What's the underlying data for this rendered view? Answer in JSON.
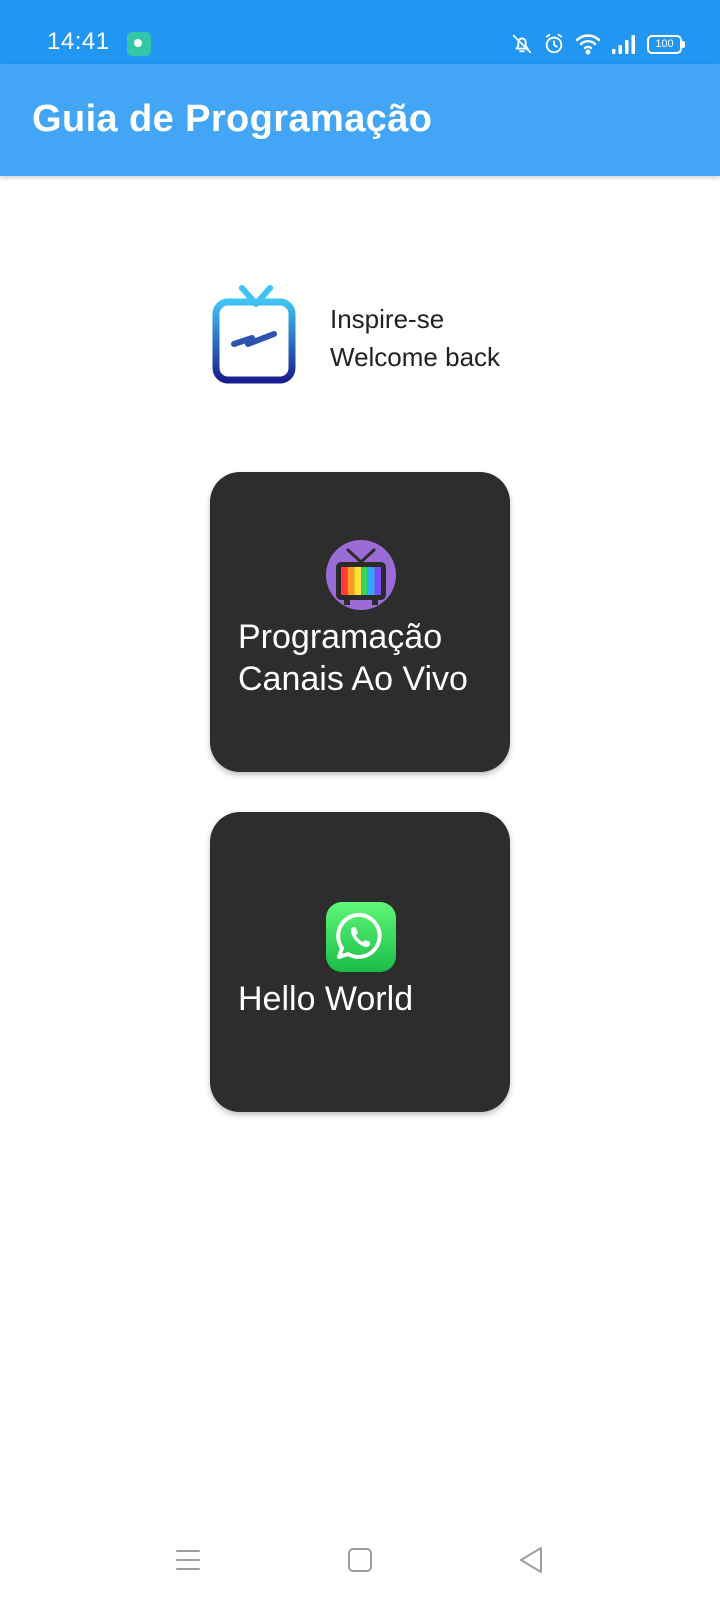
{
  "status_bar": {
    "time": "14:41",
    "notification_icon": "app-notification-icon",
    "icons": [
      "bell-off-icon",
      "alarm-icon",
      "wifi-icon",
      "signal-icon"
    ],
    "battery": "100",
    "background_color": "#2196f3"
  },
  "app_bar": {
    "title": "Guia de Programação",
    "background_color": "#42a5f5"
  },
  "header": {
    "logo_icon": "tv-logo-icon",
    "line1": "Inspire-se",
    "line2": "Welcome back"
  },
  "cards": [
    {
      "icon": "retro-tv-icon",
      "label_line1": "Programação",
      "label_line2": "Canais Ao Vivo"
    },
    {
      "icon": "whatsapp-icon",
      "label": "Hello World"
    }
  ],
  "card_color": "#2d2d2d",
  "nav_bar": {
    "buttons": [
      "menu-icon",
      "home-icon",
      "back-icon"
    ]
  }
}
